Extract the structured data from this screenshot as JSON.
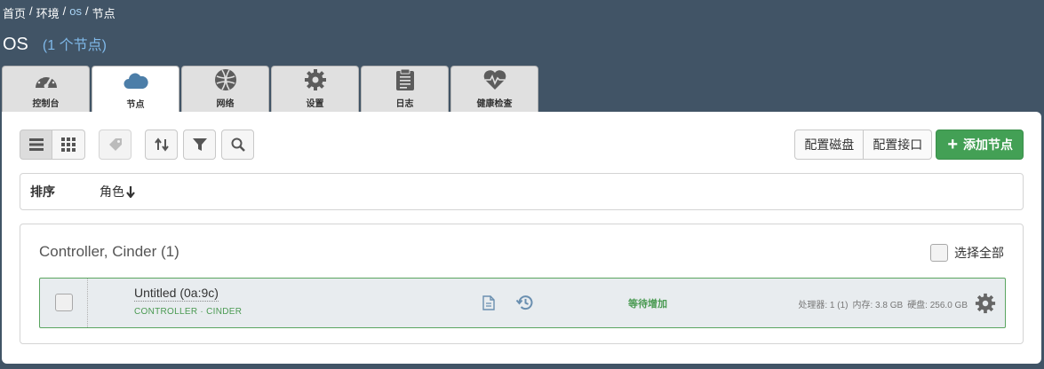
{
  "breadcrumb": {
    "home": "首页",
    "environments": "环境",
    "env": "os",
    "current": "节点",
    "sep": "/"
  },
  "header": {
    "env_name": "OS",
    "node_count": "(1 个节点)"
  },
  "tabs": [
    {
      "label": "控制台",
      "icon": "dashboard-icon",
      "active": false
    },
    {
      "label": "节点",
      "icon": "cloud-icon",
      "active": true
    },
    {
      "label": "网络",
      "icon": "network-icon",
      "active": false
    },
    {
      "label": "设置",
      "icon": "gear-icon",
      "active": false
    },
    {
      "label": "日志",
      "icon": "clipboard-icon",
      "active": false
    },
    {
      "label": "健康检查",
      "icon": "heart-pulse-icon",
      "active": false
    }
  ],
  "toolbar": {
    "configure_disks": "配置磁盘",
    "configure_interfaces": "配置接口",
    "add_nodes": "添加节点"
  },
  "sorter": {
    "label": "排序",
    "role": "角色"
  },
  "group": {
    "title": "Controller, Cinder (1)",
    "select_all": "选择全部"
  },
  "node": {
    "name": "Untitled (0a:9c)",
    "roles": "CONTROLLER · CINDER",
    "status": "等待增加",
    "cpu": "处理器: 1 (1)",
    "ram": "内存: 3.8 GB",
    "hdd": "硬盘: 256.0 GB"
  },
  "colors": {
    "background": "#415466",
    "accent_green": "#43a055",
    "node_border": "#5aa560"
  }
}
